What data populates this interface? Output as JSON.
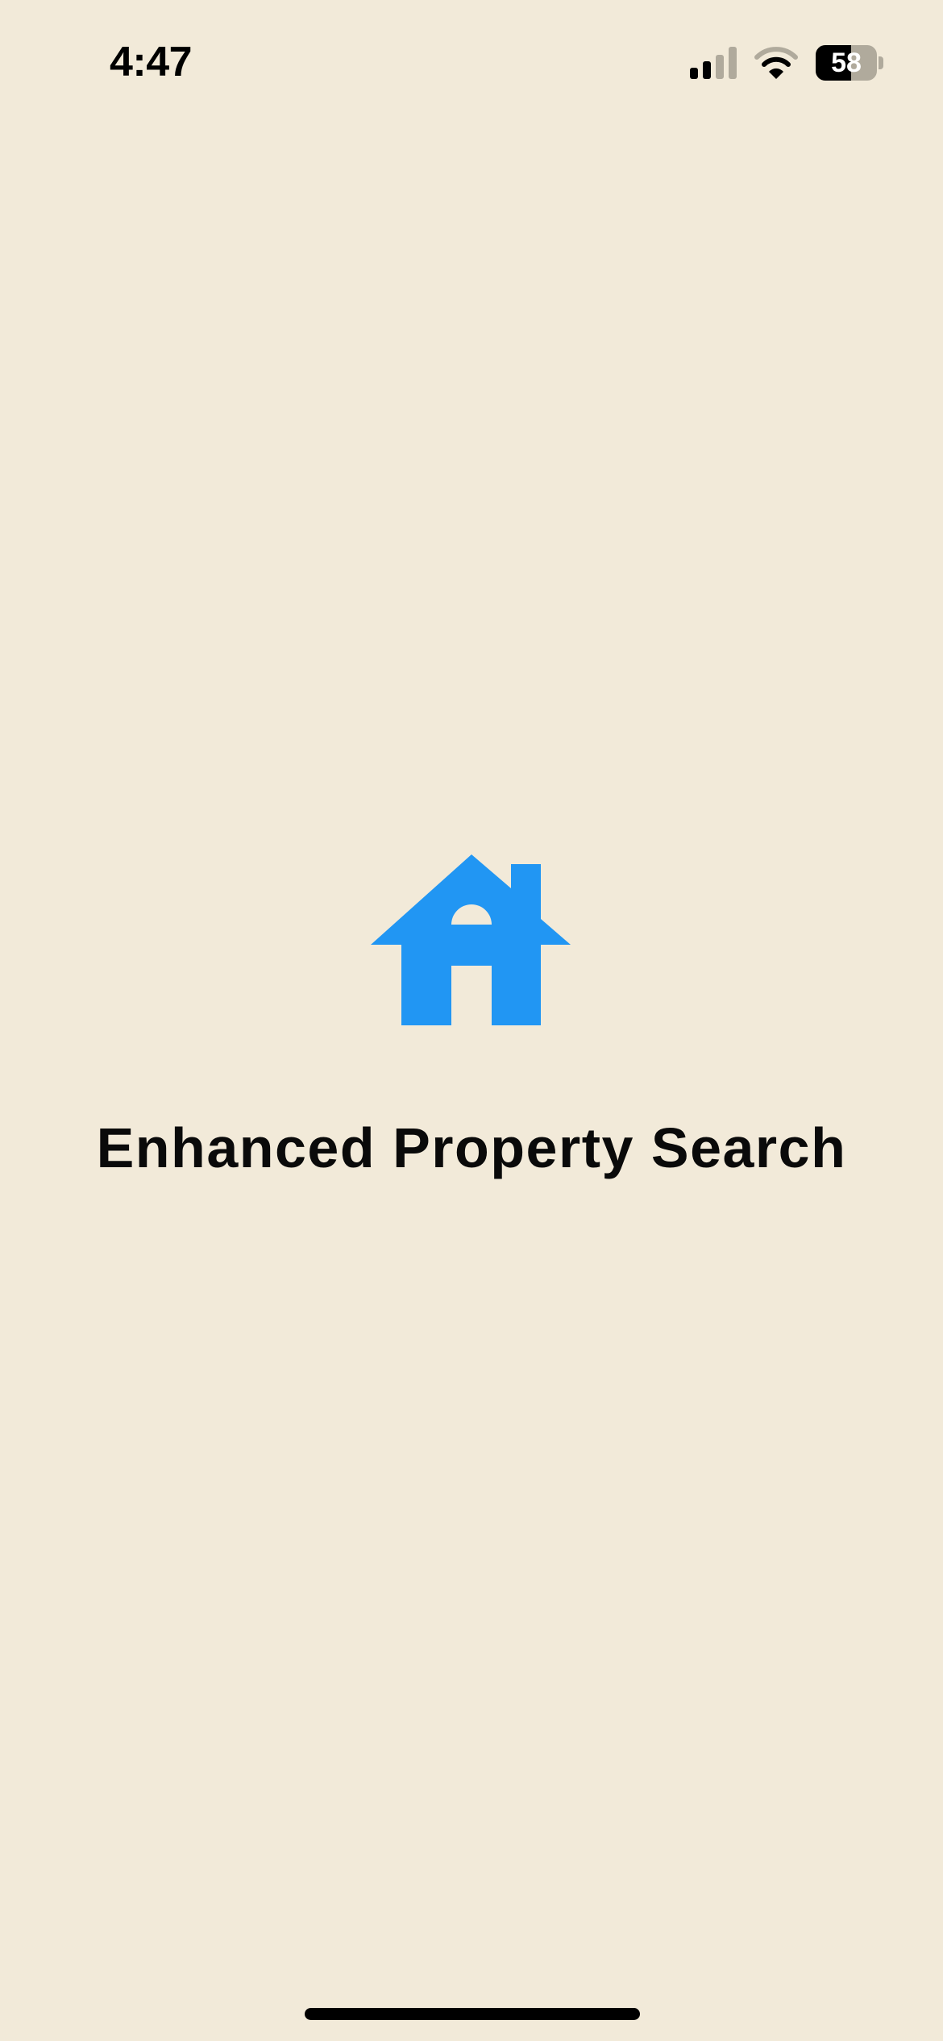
{
  "status_bar": {
    "time": "4:47",
    "battery_level": 58,
    "battery_label": "58",
    "icons": [
      "cellular-signal-icon",
      "wifi-icon",
      "battery-icon"
    ]
  },
  "splash": {
    "logo_icon": "house-icon",
    "title": "Enhanced Property Search"
  },
  "colors": {
    "background": "#f2ead9",
    "accent": "#2196f3",
    "text": "#0a0a0a"
  }
}
